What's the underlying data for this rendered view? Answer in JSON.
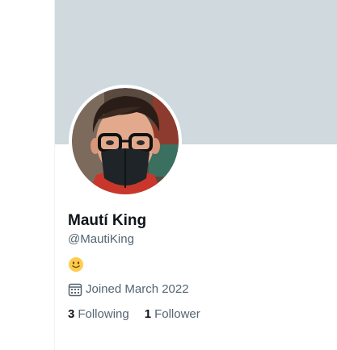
{
  "profile": {
    "display_name": "Mautí King",
    "handle": "@MautiKing",
    "bio_emoji": "slightly-smiling-face-icon",
    "joined_text": "Joined March 2022",
    "following_count": "3",
    "following_label": "Following",
    "follower_count": "1",
    "follower_label": "Follower"
  },
  "icons": {
    "calendar": "calendar-icon"
  },
  "colors": {
    "banner": "#cfd9de",
    "primary_text": "#0f1419",
    "secondary_text": "#536471",
    "emoji_yellow": "#ffcc4d"
  }
}
